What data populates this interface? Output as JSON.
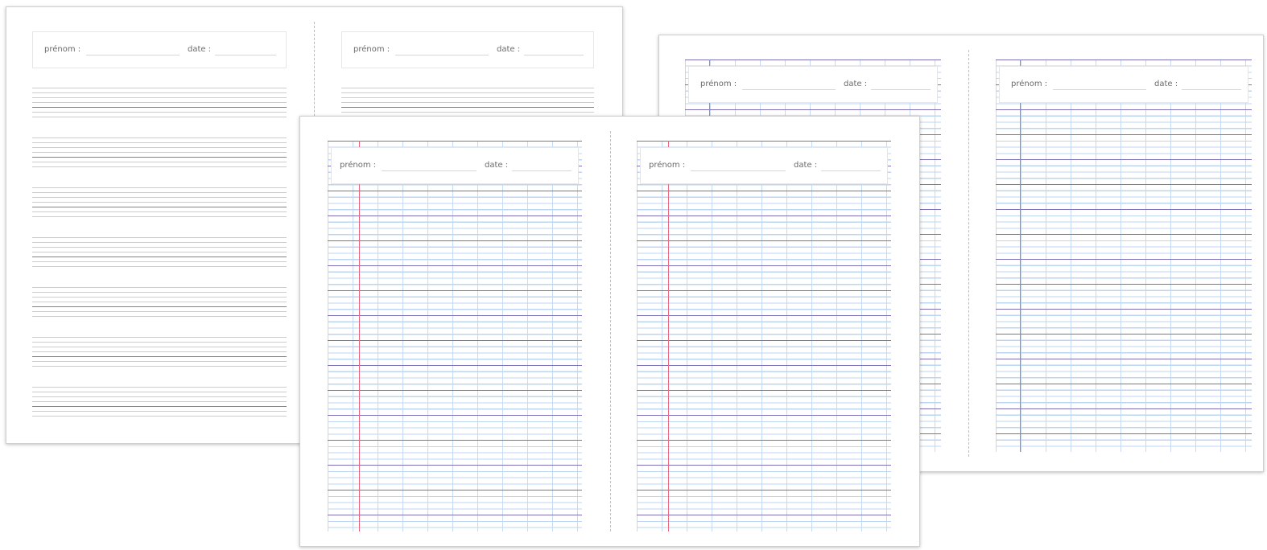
{
  "sheets": [
    {
      "style": "lined-stave",
      "pages": [
        {
          "name_label": "prénom :",
          "date_label": "date :"
        },
        {
          "name_label": "prénom :",
          "date_label": "date :"
        }
      ]
    },
    {
      "style": "seyes-grid",
      "pages": [
        {
          "name_label": "prénom :",
          "date_label": "date :"
        },
        {
          "name_label": "prénom :",
          "date_label": "date :"
        }
      ]
    },
    {
      "style": "seyes-grid",
      "pages": [
        {
          "name_label": "prénom :",
          "date_label": "date :"
        },
        {
          "name_label": "prénom :",
          "date_label": "date :"
        }
      ]
    }
  ],
  "colors": {
    "major_line": "#7b6fb7",
    "minor_line": "#bcd5f1",
    "margin_line": "#e86a84",
    "stave_line": "#d9c8be",
    "stave_base": "#8f7f79"
  }
}
